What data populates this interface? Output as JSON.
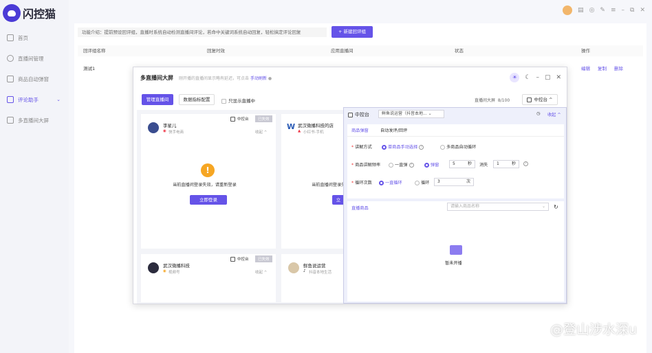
{
  "app": {
    "name": "闪控猫"
  },
  "sidebar": {
    "items": [
      {
        "label": "首页",
        "icon": "home-icon"
      },
      {
        "label": "直播间管理",
        "icon": "user-icon"
      },
      {
        "label": "商品自动弹窗",
        "icon": "window-icon"
      },
      {
        "label": "评论助手",
        "icon": "chat-icon",
        "active": true
      },
      {
        "label": "多直播间大屏",
        "icon": "screen-icon"
      }
    ]
  },
  "main": {
    "intro": "功能介绍：提前预设回评组，直播时系统自动检测直播间评论，若命中关键词系统自动回复，轻松搞定评论回复",
    "new_button": "新建回评组",
    "columns": [
      "回评组名称",
      "回复时效",
      "应用直播间",
      "状态",
      "操作"
    ],
    "rows": [
      {
        "name": "测试1",
        "actions": [
          "编辑",
          "复制",
          "删除"
        ]
      }
    ]
  },
  "modal": {
    "title": "多直播间大屏",
    "subtitle": "刚开播的直播间显示略有延迟，可点击",
    "refresh": "手动刷新",
    "manage_btn": "管理直播间",
    "metrics_btn": "数据指标配置",
    "only_live": "只显示直播中",
    "count_label": "直播间大屏",
    "count": "8/100",
    "console_btn": "中控台",
    "cards": [
      {
        "name": "李星儿",
        "platform": "快手电商",
        "control": "中控台",
        "tag": "已失效",
        "fold": "收起",
        "msg": "当前直播间登录失效，请重新登录",
        "login": "立即登录"
      },
      {
        "name": "武汉微播科技的店",
        "platform": "小红书-手机",
        "msg": "当前直播间登录失",
        "login": "立"
      },
      {
        "name": "武汉微播科技",
        "platform": "视频号",
        "control": "中控台",
        "tag": "已失效",
        "fold": "收起"
      },
      {
        "name": "鲜鱼说运营",
        "platform": "抖音本地生活"
      }
    ]
  },
  "panel": {
    "title": "中控台",
    "room": "鲜鱼说运营（抖音本地...",
    "collapse": "收起",
    "tabs": [
      "商品弹窗",
      "自动发评/回评"
    ],
    "explain_label": "讲解方式",
    "explain_opts": [
      "单商品手动选择",
      "多商品自动循环"
    ],
    "freq_label": "商品讲解频率",
    "freq_opts": [
      "一直弹",
      "弹窗"
    ],
    "pop_seconds": "5",
    "unit_sec": "秒",
    "vanish": "消失",
    "vanish_seconds": "1",
    "cycle_label": "循环次数",
    "cycle_opts": [
      "一直循环",
      "循环"
    ],
    "cycle_times": "3",
    "unit_times": "次",
    "goods_label": "直播商品",
    "goods_placeholder": "请输入商品名称",
    "empty": "暂未开播"
  },
  "watermark": "@登山涉水深u"
}
